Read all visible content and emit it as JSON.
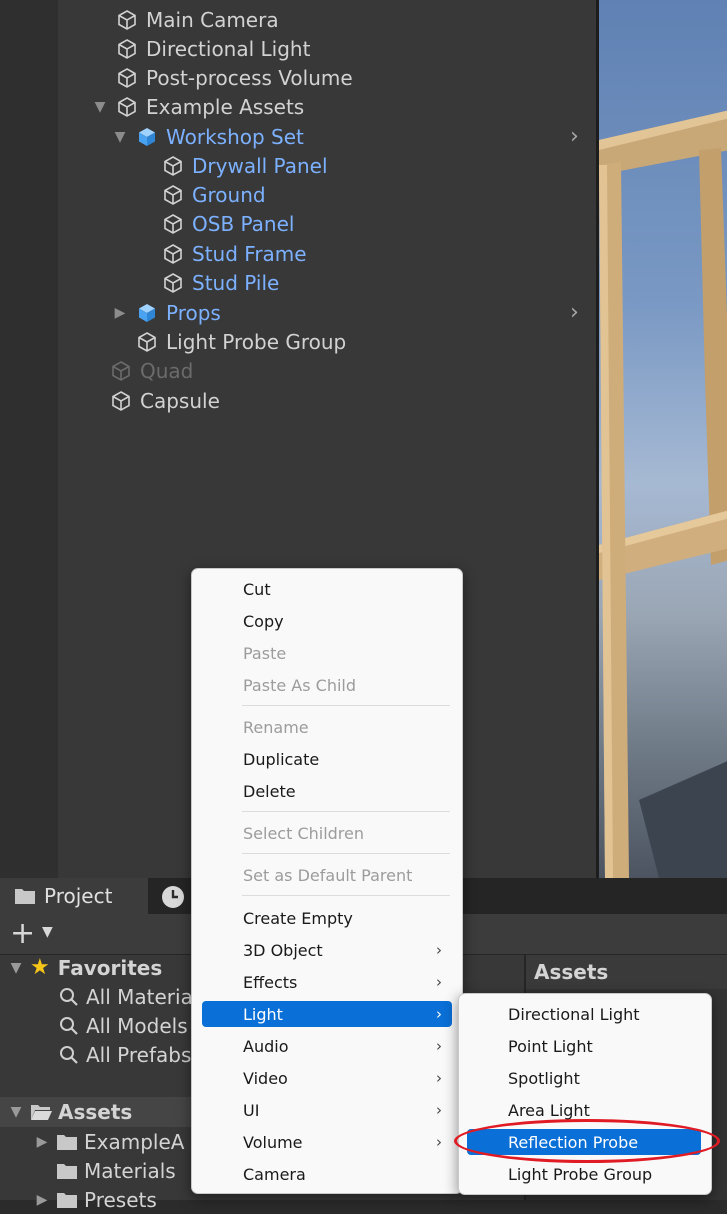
{
  "hierarchy": {
    "items": [
      {
        "label": "Main Camera",
        "state": "normal",
        "fold": "none",
        "icon": "cube-outline-icon"
      },
      {
        "label": "Directional Light",
        "state": "normal",
        "fold": "none",
        "icon": "cube-outline-icon"
      },
      {
        "label": "Post-process Volume",
        "state": "normal",
        "fold": "none",
        "icon": "cube-outline-icon"
      },
      {
        "label": "Example Assets",
        "state": "normal",
        "fold": "expanded",
        "icon": "cube-outline-icon"
      },
      {
        "label": "Workshop Set",
        "state": "prefab",
        "fold": "expanded",
        "icon": "prefab-cube-icon"
      },
      {
        "label": "Drywall Panel",
        "state": "prefab",
        "fold": "none",
        "icon": "cube-outline-icon"
      },
      {
        "label": "Ground",
        "state": "prefab",
        "fold": "none",
        "icon": "cube-outline-icon"
      },
      {
        "label": "OSB Panel",
        "state": "prefab",
        "fold": "none",
        "icon": "cube-outline-icon"
      },
      {
        "label": "Stud Frame",
        "state": "prefab",
        "fold": "none",
        "icon": "cube-outline-icon"
      },
      {
        "label": "Stud Pile",
        "state": "prefab",
        "fold": "none",
        "icon": "cube-outline-icon"
      },
      {
        "label": "Props",
        "state": "prefab",
        "fold": "collapsed",
        "icon": "prefab-cube-icon"
      },
      {
        "label": "Light Probe Group",
        "state": "normal",
        "fold": "none",
        "icon": "cube-outline-icon"
      },
      {
        "label": "Quad",
        "state": "inactive",
        "fold": "none",
        "icon": "cube-outline-icon"
      },
      {
        "label": "Capsule",
        "state": "normal",
        "fold": "none",
        "icon": "cube-outline-icon"
      }
    ]
  },
  "project": {
    "tab_label": "Project",
    "favorites": {
      "label": "Favorites",
      "items": [
        "All Materia",
        "All Models",
        "All Prefabs"
      ]
    },
    "assets": {
      "label": "Assets",
      "items": [
        "ExampleA",
        "Materials",
        "Presets"
      ]
    },
    "right_header": "Assets"
  },
  "context_menu": {
    "items": [
      {
        "label": "Cut",
        "enabled": true
      },
      {
        "label": "Copy",
        "enabled": true
      },
      {
        "label": "Paste",
        "enabled": false
      },
      {
        "label": "Paste As Child",
        "enabled": false
      },
      {
        "label": "Rename",
        "enabled": false
      },
      {
        "label": "Duplicate",
        "enabled": true
      },
      {
        "label": "Delete",
        "enabled": true
      },
      {
        "label": "Select Children",
        "enabled": false
      },
      {
        "label": "Set as Default Parent",
        "enabled": false
      },
      {
        "label": "Create Empty",
        "enabled": true
      },
      {
        "label": "3D Object",
        "enabled": true,
        "submenu": true
      },
      {
        "label": "Effects",
        "enabled": true,
        "submenu": true
      },
      {
        "label": "Light",
        "enabled": true,
        "submenu": true,
        "active": true
      },
      {
        "label": "Audio",
        "enabled": true,
        "submenu": true
      },
      {
        "label": "Video",
        "enabled": true,
        "submenu": true
      },
      {
        "label": "UI",
        "enabled": true,
        "submenu": true
      },
      {
        "label": "Volume",
        "enabled": true,
        "submenu": true
      },
      {
        "label": "Camera",
        "enabled": true
      }
    ]
  },
  "light_submenu": {
    "items": [
      {
        "label": "Directional Light"
      },
      {
        "label": "Point Light"
      },
      {
        "label": "Spotlight"
      },
      {
        "label": "Area Light"
      },
      {
        "label": "Reflection Probe",
        "active": true,
        "circled": true
      },
      {
        "label": "Light Probe Group"
      }
    ]
  },
  "colors": {
    "menu_highlight": "#0a6fd6",
    "prefab_text": "#7cb1ff",
    "circle_annotation": "#e01b24"
  }
}
